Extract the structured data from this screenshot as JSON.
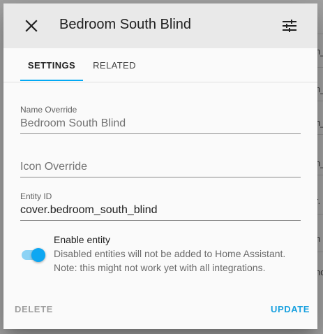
{
  "background": {
    "fragments": [
      "n_",
      "n_",
      "n_",
      "n_",
      "n_",
      "n_",
      "n_",
      "r.",
      "n",
      "no"
    ]
  },
  "dialog": {
    "title": "Bedroom South Blind",
    "close_icon": "close-icon",
    "settings_icon": "tune-icon"
  },
  "tabs": [
    {
      "label": "SETTINGS",
      "active": true
    },
    {
      "label": "RELATED",
      "active": false
    }
  ],
  "fields": {
    "name_override": {
      "label": "Name Override",
      "value": "Bedroom South Blind"
    },
    "icon_override": {
      "placeholder": "Icon Override",
      "value": ""
    },
    "entity_id": {
      "label": "Entity ID",
      "value": "cover.bedroom_south_blind"
    }
  },
  "enable_entity": {
    "enabled": true,
    "title": "Enable entity",
    "description": "Disabled entities will not be added to Home Assistant. Note: this might not work yet with all integrations."
  },
  "actions": {
    "delete_label": "DELETE",
    "update_label": "UPDATE"
  },
  "colors": {
    "accent": "#03a9f4",
    "update": "#1aa1df",
    "toggle_thumb": "#0ea7f2",
    "toggle_track": "#8dd3f5"
  }
}
